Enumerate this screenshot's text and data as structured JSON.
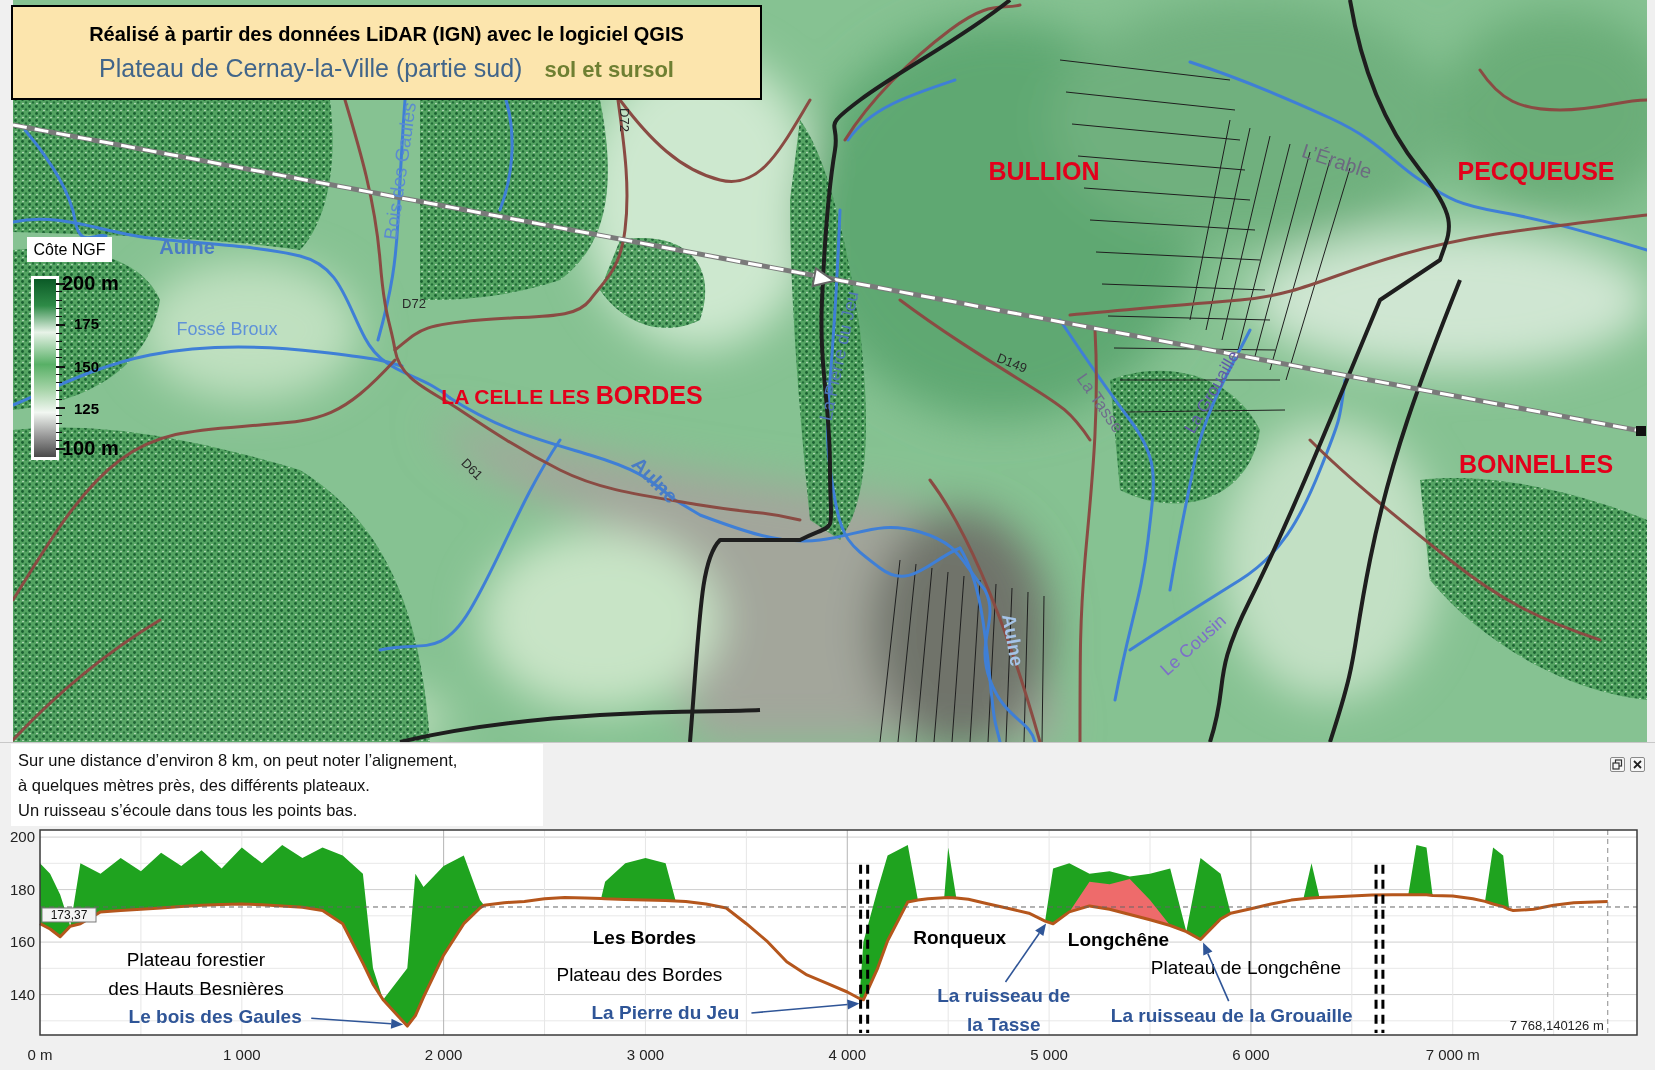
{
  "title_box": {
    "heading": "Réalisé à partir des données LiDAR (IGN) avec le logiciel QGIS",
    "subtitle": "Plateau de Cernay-la-Ville (partie sud)",
    "layer_note": "sol et sursol"
  },
  "legend": {
    "title": "Côte NGF",
    "labels": [
      "200 m",
      "175",
      "150",
      "125",
      "100 m"
    ]
  },
  "map_labels": [
    {
      "kind": "river",
      "text": "Bois des Gaules"
    },
    {
      "kind": "road",
      "text": "D72"
    },
    {
      "kind": "commune",
      "text": "BULLION"
    },
    {
      "kind": "river",
      "text": "L’Érable"
    },
    {
      "kind": "commune",
      "text": "PECQUEUSE"
    },
    {
      "kind": "river",
      "text": "Aulne"
    },
    {
      "kind": "river",
      "text": "La Pierre du Jeu"
    },
    {
      "kind": "road",
      "text": "D72"
    },
    {
      "kind": "river",
      "text": "Fossé Broux"
    },
    {
      "kind": "road",
      "text": "D149"
    },
    {
      "kind": "river",
      "text": "La Tasse"
    },
    {
      "kind": "river",
      "text": "La Grouaille"
    },
    {
      "kind": "commune",
      "prefix": "LA CELLE LES",
      "text": "BORDES"
    },
    {
      "kind": "commune",
      "text": "BONNELLES"
    },
    {
      "kind": "road",
      "text": "D61"
    },
    {
      "kind": "river",
      "text": "Aulne"
    },
    {
      "kind": "river",
      "text": "Aulne"
    },
    {
      "kind": "river",
      "text": "Le Cousin"
    }
  ],
  "profile_panel": {
    "note_lines": [
      "Sur une distance d’environ 8 km, on peut noter l’alignement,",
      "à quelques mètres près, des différents plateaux.",
      "Un ruisseau s’écoule dans tous les points bas."
    ],
    "chart_data": {
      "type": "area",
      "grid": true,
      "x": [
        0,
        50,
        100,
        150,
        200,
        300,
        400,
        500,
        600,
        700,
        800,
        900,
        1000,
        1100,
        1200,
        1300,
        1400,
        1500,
        1600,
        1650,
        1700,
        1820,
        1860,
        1900,
        2000,
        2100,
        2180,
        2200,
        2300,
        2400,
        2500,
        2600,
        2700,
        2780,
        2800,
        2900,
        3000,
        3100,
        3150,
        3200,
        3300,
        3400,
        3500,
        3600,
        3700,
        3800,
        3900,
        4000,
        4060,
        4080,
        4150,
        4200,
        4300,
        4350,
        4400,
        4480,
        4500,
        4540,
        4600,
        4700,
        4800,
        4900,
        4980,
        5020,
        5100,
        5200,
        5300,
        5400,
        5500,
        5600,
        5680,
        5750,
        5850,
        5900,
        6000,
        6100,
        6200,
        6260,
        6300,
        6340,
        6400,
        6500,
        6600,
        6700,
        6780,
        6820,
        6870,
        6900,
        7000,
        7100,
        7160,
        7200,
        7250,
        7280,
        7300,
        7400,
        7500,
        7600,
        7700,
        7768
      ],
      "series": [
        {
          "color": "#1fa31f",
          "values": [
            190,
            186,
            178,
            166,
            190,
            186,
            192,
            187,
            194,
            189,
            195,
            188,
            196,
            190,
            197,
            192,
            196,
            193,
            186,
            150,
            138,
            150,
            186,
            181,
            189,
            193,
            176,
            174,
            175,
            175.5,
            176.5,
            177,
            176.8,
            176.6,
            183,
            190,
            192,
            190,
            175.6,
            175.5,
            174.5,
            173,
            167,
            160.5,
            152.5,
            147.5,
            144.3,
            141,
            138.5,
            160,
            180,
            193,
            197,
            176,
            176.5,
            176.9,
            196,
            176.8,
            176.3,
            174.5,
            172.8,
            171,
            168,
            188,
            190,
            186,
            187,
            185,
            186,
            188,
            164,
            192,
            186,
            171,
            172.7,
            174.5,
            176,
            176.5,
            190,
            177,
            177.2,
            177.5,
            177.9,
            178,
            178,
            197,
            196,
            177.7,
            177.5,
            176.5,
            175.5,
            196,
            193,
            172.5,
            172,
            172.5,
            174,
            175,
            175.3,
            175.5
          ]
        },
        {
          "color": "#ee6b6b",
          "values": [
            null,
            null,
            null,
            null,
            null,
            null,
            null,
            null,
            null,
            null,
            null,
            null,
            null,
            null,
            null,
            null,
            null,
            null,
            null,
            null,
            null,
            null,
            null,
            null,
            null,
            null,
            null,
            null,
            null,
            null,
            null,
            null,
            null,
            null,
            null,
            null,
            null,
            null,
            null,
            null,
            null,
            null,
            null,
            null,
            null,
            null,
            null,
            null,
            null,
            null,
            null,
            null,
            null,
            null,
            null,
            null,
            null,
            null,
            null,
            null,
            null,
            null,
            null,
            null,
            171.5,
            183,
            182,
            184,
            176,
            166.3,
            null,
            null,
            null,
            null,
            null,
            null,
            null,
            null,
            null,
            null,
            null,
            null,
            null,
            null,
            null,
            null,
            null,
            null,
            null,
            null,
            null,
            null,
            null,
            null,
            null,
            null,
            null,
            null,
            null,
            null
          ]
        },
        {
          "type": "line",
          "color": "#b5561c",
          "values": [
            167,
            165,
            162,
            166,
            167,
            171.5,
            172,
            172.5,
            173,
            173.5,
            174,
            174.3,
            174.5,
            174.2,
            173.8,
            173.3,
            172,
            167,
            152,
            144,
            138,
            128,
            132,
            139,
            155,
            167,
            173,
            174,
            175,
            175.5,
            176.5,
            177,
            176.8,
            176.6,
            176.5,
            176.2,
            176,
            175.8,
            175.6,
            175.5,
            174.5,
            173,
            167,
            160.5,
            152.5,
            147.5,
            144.3,
            141,
            138.5,
            138,
            150,
            160.5,
            175.3,
            176,
            176.5,
            176.9,
            177,
            176.8,
            176.3,
            174.5,
            172.8,
            171,
            168,
            167,
            171.5,
            173.8,
            172.5,
            170.5,
            168.5,
            166.3,
            164,
            161,
            168.8,
            171,
            172.7,
            174.5,
            176,
            176.5,
            176.8,
            177,
            177.2,
            177.5,
            177.9,
            178,
            178,
            178,
            178,
            177.7,
            177.5,
            176.5,
            175.5,
            174.5,
            173.5,
            172.5,
            172,
            172.5,
            174,
            175,
            175.3,
            175.5
          ]
        }
      ],
      "xlim": [
        0,
        7913
      ],
      "ylim": [
        124.6,
        202.7
      ],
      "xticks": [
        {
          "value": 0,
          "label": "0 m"
        },
        {
          "value": 1000,
          "label": "1 000"
        },
        {
          "value": 2000,
          "label": "2 000"
        },
        {
          "value": 3000,
          "label": "3 000"
        },
        {
          "value": 4000,
          "label": "4 000"
        },
        {
          "value": 5000,
          "label": "5 000"
        },
        {
          "value": 6000,
          "label": "6 000"
        },
        {
          "value": 7000,
          "label": "7 000 m"
        }
      ],
      "yticks": [
        140,
        160,
        180,
        200
      ],
      "ref_lines": [
        {
          "axis": "y",
          "value": 173.37,
          "label": "173,37",
          "color": "#666666"
        },
        {
          "axis": "x",
          "value": 4066,
          "color": "#000000"
        },
        {
          "axis": "x",
          "value": 4101,
          "color": "#000000"
        },
        {
          "axis": "x",
          "value": 6620,
          "color": "#000000"
        },
        {
          "axis": "x",
          "value": 6654,
          "color": "#000000"
        },
        {
          "axis": "x",
          "value": 7768.14,
          "label": "7 768,140126 m",
          "color": "#8a8a8a"
        }
      ],
      "annotations": [
        {
          "text": "Plateau forestier\ndes Hauts Besnières"
        },
        {
          "text": "Le bois des Gaules"
        },
        {
          "text": "Les Bordes"
        },
        {
          "text": "Plateau des Bordes"
        },
        {
          "text": "La Pierre du Jeu"
        },
        {
          "text": "Ronqueux"
        },
        {
          "text": "La ruisseau de\nla Tasse"
        },
        {
          "text": "Longchêne"
        },
        {
          "text": "Plateau de Longchêne"
        },
        {
          "text": "La ruisseau de la Grouaille"
        }
      ]
    }
  }
}
